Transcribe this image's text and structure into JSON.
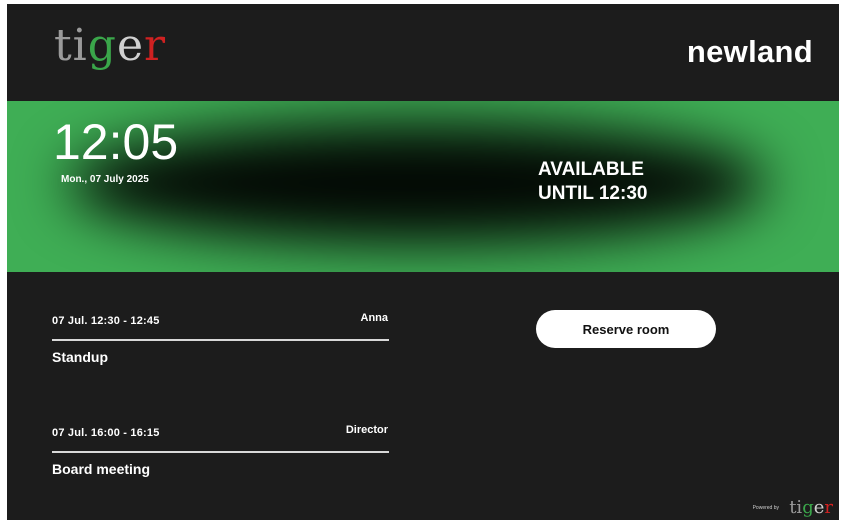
{
  "header": {
    "logo_letters": [
      "ti",
      "g",
      "e",
      "r"
    ],
    "brand": "newland"
  },
  "status": {
    "time": "12:05",
    "date": "Mon., 07 July 2025",
    "line1": "AVAILABLE",
    "line2": "UNTIL 12:30",
    "color": "#3fae55"
  },
  "meetings": [
    {
      "time": "07   Jul. 12:30 - 12:45",
      "host": "Anna",
      "title": "Standup"
    },
    {
      "time": "07   Jul. 16:00 - 16:15",
      "host": "Director",
      "title": "Board meeting"
    }
  ],
  "actions": {
    "reserve_label": "Reserve room"
  },
  "footer": {
    "powered_label": "Powered by",
    "logo_letters": [
      "ti",
      "g",
      "e",
      "r"
    ]
  }
}
